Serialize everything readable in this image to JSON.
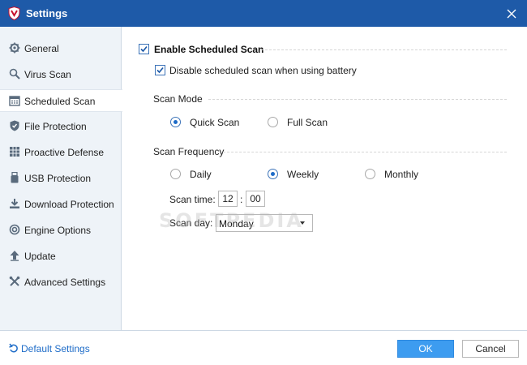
{
  "window": {
    "title": "Settings"
  },
  "sidebar": {
    "items": [
      {
        "label": "General",
        "icon": "gear-icon"
      },
      {
        "label": "Virus Scan",
        "icon": "magnifier-icon"
      },
      {
        "label": "Scheduled Scan",
        "icon": "calendar-icon",
        "active": true
      },
      {
        "label": "File Protection",
        "icon": "shield-icon"
      },
      {
        "label": "Proactive Defense",
        "icon": "grid-icon"
      },
      {
        "label": "USB Protection",
        "icon": "usb-icon"
      },
      {
        "label": "Download Protection",
        "icon": "download-icon"
      },
      {
        "label": "Engine Options",
        "icon": "engine-icon"
      },
      {
        "label": "Update",
        "icon": "upload-arrow-icon"
      },
      {
        "label": "Advanced Settings",
        "icon": "tools-icon"
      }
    ]
  },
  "scheduled": {
    "enable_label": "Enable Scheduled Scan",
    "enable_checked": true,
    "battery_label": "Disable scheduled scan when using battery",
    "battery_checked": true,
    "scan_mode": {
      "title": "Scan Mode",
      "options": [
        "Quick Scan",
        "Full Scan"
      ],
      "selected": "Quick Scan"
    },
    "frequency": {
      "title": "Scan Frequency",
      "options": [
        "Daily",
        "Weekly",
        "Monthly"
      ],
      "selected": "Weekly"
    },
    "scan_time": {
      "label": "Scan time:",
      "hour": "12",
      "separator": ":",
      "minute": "00"
    },
    "scan_day": {
      "label": "Scan day:",
      "value": "Monday"
    }
  },
  "watermark": "SOFTPEDIA",
  "footer": {
    "default_label": "Default Settings",
    "ok_label": "OK",
    "cancel_label": "Cancel"
  },
  "colors": {
    "titlebar": "#1e5aa8",
    "sidebar_bg": "#eef3f8",
    "accent": "#1e6cc8",
    "ok_button": "#3d9cf0"
  }
}
